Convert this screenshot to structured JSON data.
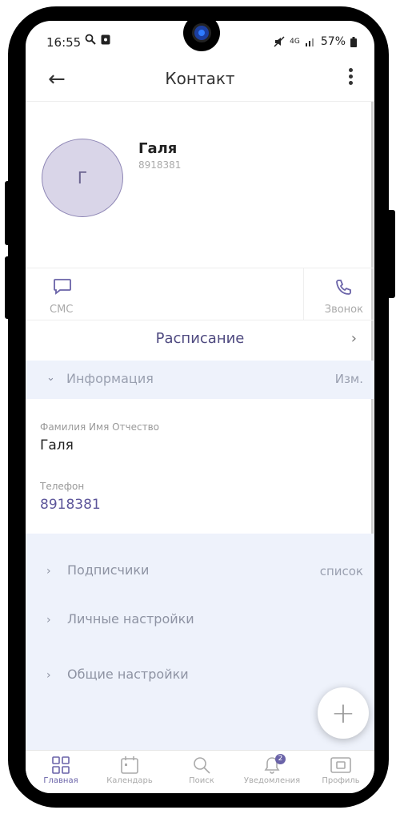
{
  "status_bar": {
    "time": "16:55",
    "network": "4G",
    "battery": "57%"
  },
  "header": {
    "title": "Контакт"
  },
  "contact": {
    "initial": "Г",
    "name": "Галя",
    "phone": "8918381"
  },
  "actions": {
    "sms_label": "СМС",
    "call_label": "Звонок"
  },
  "schedule": {
    "label": "Расписание"
  },
  "info": {
    "section_label": "Информация",
    "edit_label": "Изм.",
    "fio_label": "Фамилия Имя Отчество",
    "fio_value": "Галя",
    "phone_label": "Телефон",
    "phone_value": "8918381"
  },
  "settings": {
    "subscribers_label": "Подписчики",
    "subscribers_action": "список",
    "personal_label": "Личные настройки",
    "general_label": "Общие настройки"
  },
  "fab": {
    "symbol": "+"
  },
  "bottom_nav": {
    "tabs": [
      {
        "label": "Главная",
        "icon": "grid-icon",
        "active": true
      },
      {
        "label": "Календарь",
        "icon": "calendar-icon",
        "active": false
      },
      {
        "label": "Поиск",
        "icon": "search-icon",
        "active": false
      },
      {
        "label": "Уведомления",
        "icon": "bell-icon",
        "active": false,
        "badge": "2"
      },
      {
        "label": "Профиль",
        "icon": "profile-icon",
        "active": false
      }
    ]
  },
  "colors": {
    "accent": "#4f4a80",
    "section_bg": "#eef2fb",
    "avatar_bg": "#d9d5e8",
    "phone_link": "#5c559a"
  }
}
